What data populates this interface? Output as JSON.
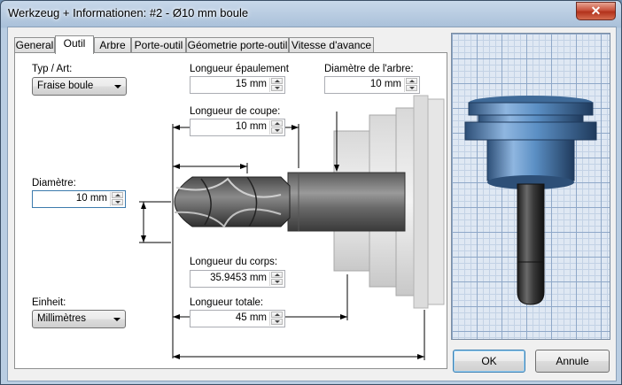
{
  "window": {
    "title": "Werkzeug + Informationen: #2 - Ø10 mm boule",
    "close_glyph": "✕"
  },
  "tabs": [
    {
      "label": "General"
    },
    {
      "label": "Outil"
    },
    {
      "label": "Arbre"
    },
    {
      "label": "Porte-outil"
    },
    {
      "label": "Géometrie porte-outil"
    },
    {
      "label": "Vitesse d'avance"
    }
  ],
  "active_tab": "Outil",
  "fields": {
    "type": {
      "label": "Typ / Art:",
      "value": "Fraise boule"
    },
    "shoulder_length": {
      "label": "Longueur épaulement",
      "value": "15 mm"
    },
    "shaft_diameter": {
      "label": "Diamètre de l'arbre:",
      "value": "10 mm"
    },
    "cutting_length": {
      "label": "Longueur de coupe:",
      "value": "10 mm"
    },
    "diameter": {
      "label": "Diamètre:",
      "value": "10 mm"
    },
    "body_length": {
      "label": "Longueur du corps:",
      "value": "35.9453 mm"
    },
    "total_length": {
      "label": "Longueur totale:",
      "value": "45 mm"
    },
    "unit": {
      "label": "Einheit:",
      "value": "Millimètres"
    }
  },
  "buttons": {
    "ok": "OK",
    "cancel": "Annule"
  },
  "colors": {
    "accent": "#3c7fb1",
    "tool_blue": "#5b8fc4",
    "tool_dark": "#3a3a3a"
  }
}
